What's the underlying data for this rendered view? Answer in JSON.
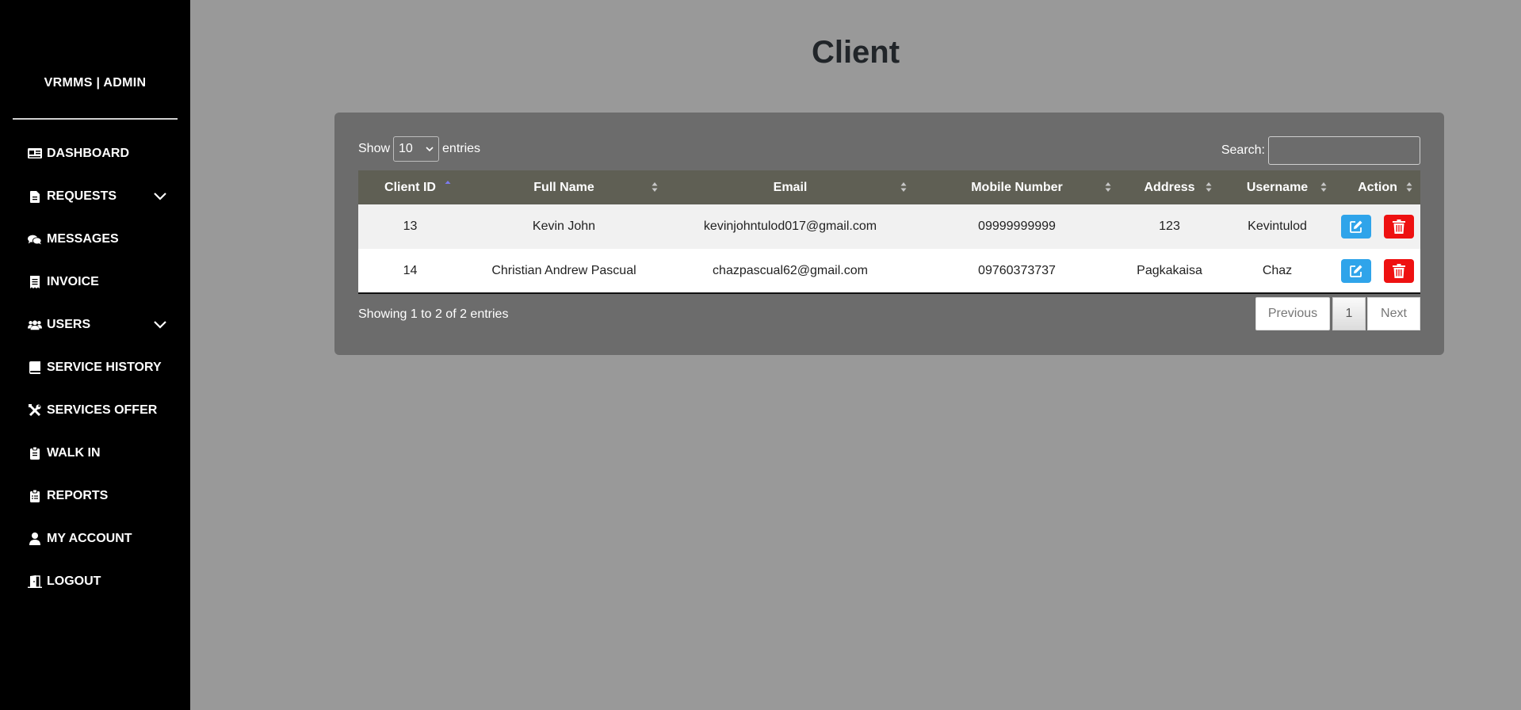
{
  "sidebar": {
    "brand": "VRMMS | ADMIN",
    "items": [
      {
        "label": "DASHBOARD",
        "icon": "dashboard-icon"
      },
      {
        "label": "REQUESTS",
        "icon": "file-icon",
        "has_dropdown": true
      },
      {
        "label": "MESSAGES",
        "icon": "comments-icon"
      },
      {
        "label": "INVOICE",
        "icon": "receipt-icon"
      },
      {
        "label": "USERS",
        "icon": "users-icon",
        "has_dropdown": true
      },
      {
        "label": "SERVICE HISTORY",
        "icon": "book-icon"
      },
      {
        "label": "SERVICES OFFER",
        "icon": "tools-icon"
      },
      {
        "label": "WALK IN",
        "icon": "clipboard-icon"
      },
      {
        "label": "REPORTS",
        "icon": "clipboard-list-icon"
      },
      {
        "label": "MY ACCOUNT",
        "icon": "user-icon"
      },
      {
        "label": "LOGOUT",
        "icon": "door-icon"
      }
    ]
  },
  "page": {
    "title": "Client"
  },
  "table_controls": {
    "show_label": "Show",
    "entries_value": "10",
    "entries_label": "entries",
    "search_label": "Search:",
    "search_value": ""
  },
  "table": {
    "columns": [
      "Client ID",
      "Full Name",
      "Email",
      "Mobile Number",
      "Address",
      "Username",
      "Action"
    ],
    "sorted_column": "Client ID",
    "rows": [
      [
        "13",
        "Kevin John",
        "kevinjohntulod017@gmail.com",
        "09999999999",
        "123",
        "Kevintulod"
      ],
      [
        "14",
        "Christian Andrew Pascual",
        "chazpascual62@gmail.com",
        "09760373737",
        "Pagkakaisa",
        "Chaz"
      ]
    ]
  },
  "footer": {
    "info": "Showing 1 to 2 of 2 entries",
    "previous": "Previous",
    "current_page": "1",
    "next": "Next"
  },
  "colors": {
    "sidebar_bg": "#000000",
    "page_bg": "#999999",
    "panel_bg": "#6c6c6c",
    "header_bg": "#5f5f54",
    "edit_button": "#2fa4ea",
    "delete_button": "#ee1111"
  }
}
